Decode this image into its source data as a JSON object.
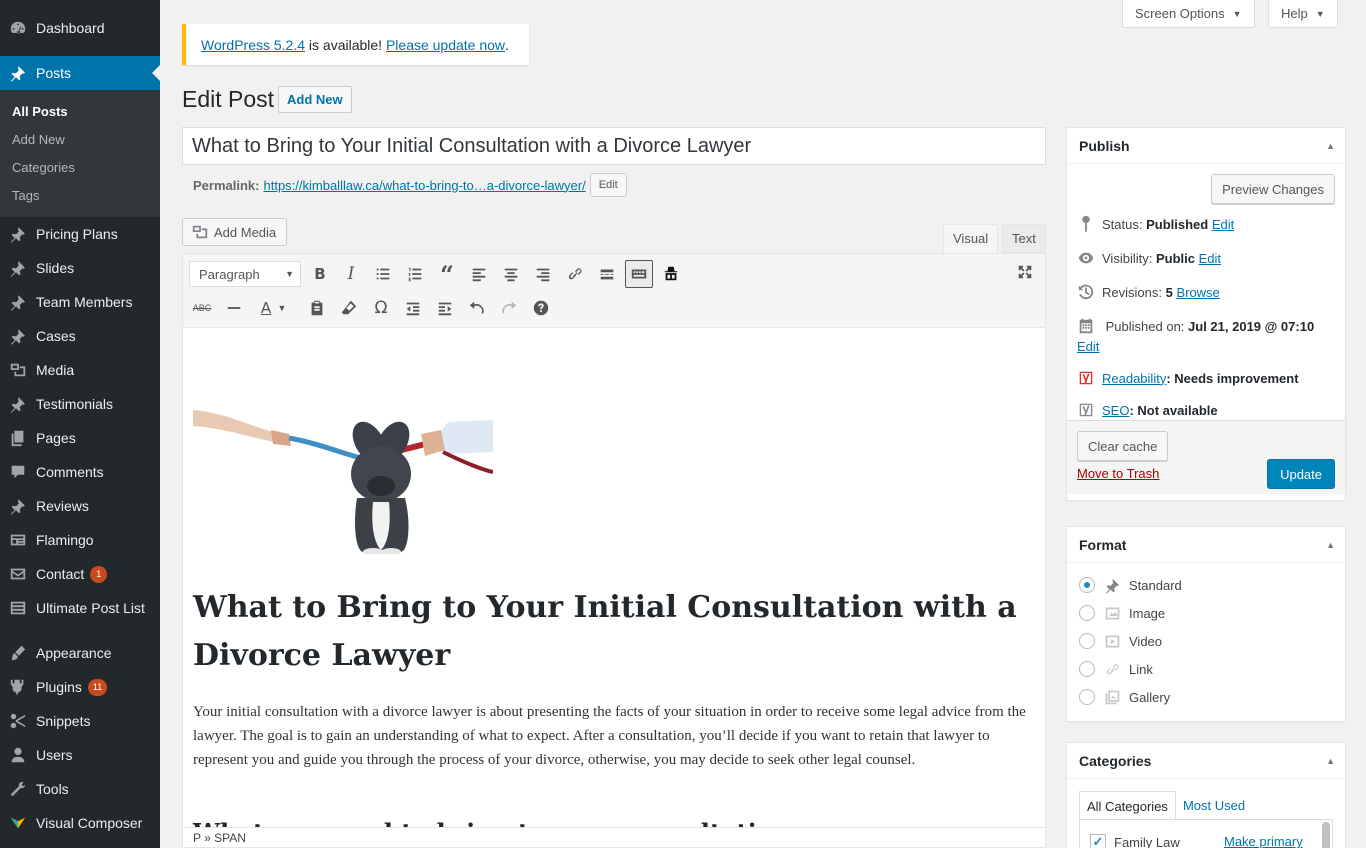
{
  "sidebar": {
    "items": [
      {
        "label": "Dashboard",
        "icon": "dashboard-icon"
      },
      {
        "label": "Posts",
        "icon": "pin-icon"
      },
      {
        "label": "Pricing Plans",
        "icon": "pin-icon"
      },
      {
        "label": "Slides",
        "icon": "pin-icon"
      },
      {
        "label": "Team Members",
        "icon": "pin-icon"
      },
      {
        "label": "Cases",
        "icon": "pin-icon"
      },
      {
        "label": "Media",
        "icon": "media-icon"
      },
      {
        "label": "Testimonials",
        "icon": "pin-icon"
      },
      {
        "label": "Pages",
        "icon": "pages-icon"
      },
      {
        "label": "Comments",
        "icon": "comments-icon"
      },
      {
        "label": "Reviews",
        "icon": "pin-icon"
      },
      {
        "label": "Flamingo",
        "icon": "flamingo-icon"
      },
      {
        "label": "Contact",
        "icon": "mail-icon",
        "badge": "1"
      },
      {
        "label": "Ultimate Post List",
        "icon": "list-icon"
      },
      {
        "label": "Appearance",
        "icon": "brush-icon"
      },
      {
        "label": "Plugins",
        "icon": "plugin-icon",
        "badge": "11"
      },
      {
        "label": "Snippets",
        "icon": "scissors-icon"
      },
      {
        "label": "Users",
        "icon": "users-icon"
      },
      {
        "label": "Tools",
        "icon": "wrench-icon"
      },
      {
        "label": "Visual Composer",
        "icon": "vc-icon"
      }
    ],
    "posts_submenu": [
      "All Posts",
      "Add New",
      "Categories",
      "Tags"
    ]
  },
  "top": {
    "screen_options": "Screen Options",
    "help": "Help"
  },
  "notice": {
    "version_link": "WordPress 5.2.4",
    "middle": " is available! ",
    "update_link": "Please update now",
    "end": "."
  },
  "header": {
    "title": "Edit Post",
    "add_new": "Add New"
  },
  "post": {
    "title": "What to Bring to Your Initial Consultation with a Divorce Lawyer",
    "permalink_label": "Permalink:",
    "permalink_url": "https://kimballlaw.ca/what-to-bring-to…a-divorce-lawyer/",
    "permalink_edit": "Edit"
  },
  "editor": {
    "add_media": "Add Media",
    "tab_visual": "Visual",
    "tab_text": "Text",
    "format_select": "Paragraph",
    "heading": "What to Bring to Your Initial Consultation with a Divorce Lawyer",
    "paragraph": "Your initial consultation with a divorce lawyer is about presenting the facts of your situation in order to receive some legal advice from the lawyer. The goal is to gain an understanding of what to expect. After a consultation, you’ll decide if you want to retain that lawyer to represent you and guide you through the process of your divorce, otherwise, you may decide to seek other legal counsel.",
    "subheading": "What you need to bring to your consultation",
    "status_path": "P » SPAN"
  },
  "publish": {
    "title": "Publish",
    "preview": "Preview Changes",
    "status_label": "Status: ",
    "status_value": "Published",
    "visibility_label": "Visibility: ",
    "visibility_value": "Public",
    "revisions_label": "Revisions: ",
    "revisions_value": "5",
    "browse": "Browse",
    "published_label": "Published on: ",
    "published_value": "Jul 21, 2019 @ 07:10",
    "edit": "Edit",
    "readability_link": "Readability",
    "readability_value": ": Needs improvement",
    "seo_link": "SEO",
    "seo_value": ": Not available",
    "clear_cache": "Clear cache",
    "trash": "Move to Trash",
    "update": "Update"
  },
  "format": {
    "title": "Format",
    "options": [
      {
        "label": "Standard",
        "icon": "pin-icon",
        "checked": true
      },
      {
        "label": "Image",
        "icon": "image-icon",
        "checked": false
      },
      {
        "label": "Video",
        "icon": "video-icon",
        "checked": false
      },
      {
        "label": "Link",
        "icon": "link-icon",
        "checked": false
      },
      {
        "label": "Gallery",
        "icon": "gallery-icon",
        "checked": false
      }
    ]
  },
  "categories": {
    "title": "Categories",
    "tab_all": "All Categories",
    "tab_most_used": "Most Used",
    "items": [
      {
        "label": "Family Law",
        "checked": true,
        "action": "Make primary"
      }
    ]
  },
  "colors": {
    "sidebar_bg": "#23282d",
    "accent": "#0073aa",
    "primary_button": "#0085ba",
    "notice_border": "#ffb900",
    "badge": "#ca4a1f",
    "trash": "#a00"
  }
}
